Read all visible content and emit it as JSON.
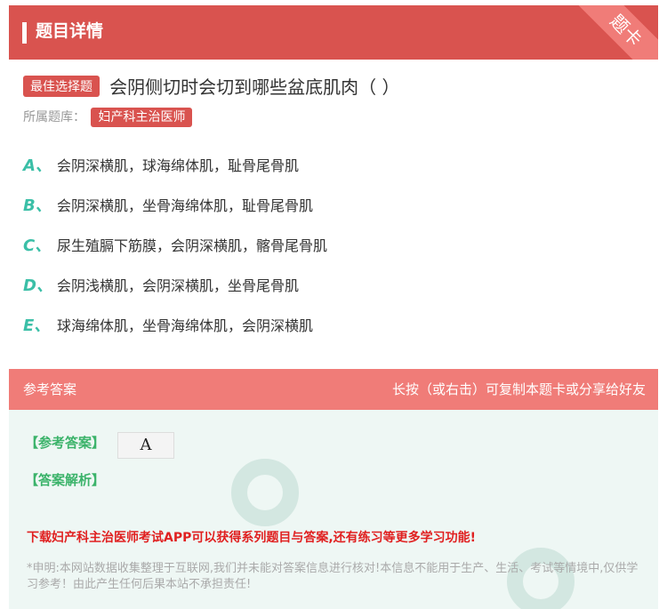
{
  "header": {
    "title": "题目详情",
    "ribbon": "题卡"
  },
  "question": {
    "type_tag": "最佳选择题",
    "text": "会阴侧切时会切到哪些盆底肌肉（ ）"
  },
  "bank": {
    "label": "所属题库：",
    "name": "妇产科主治医师"
  },
  "options": [
    {
      "letter": "A、",
      "text": "会阴深横肌，球海绵体肌，耻骨尾骨肌"
    },
    {
      "letter": "B、",
      "text": "会阴深横肌，坐骨海绵体肌，耻骨尾骨肌"
    },
    {
      "letter": "C、",
      "text": "尿生殖膈下筋膜，会阴深横肌，髂骨尾骨肌"
    },
    {
      "letter": "D、",
      "text": "会阴浅横肌，会阴深横肌，坐骨尾骨肌"
    },
    {
      "letter": "E、",
      "text": "球海绵体肌，坐骨海绵体肌，会阴深横肌"
    }
  ],
  "answer_bar": {
    "left": "参考答案",
    "right": "长按（或右击）可复制本题卡或分享给好友"
  },
  "answer": {
    "ref_label": "【参考答案】",
    "ref_value": "A",
    "analysis_label": "【答案解析】",
    "promo": "下载妇产科主治医师考试APP可以获得系列题目与答案,还有练习等更多学习功能!",
    "disclaimer": "*申明:本网站数据收集整理于互联网,我们并未能对答案信息进行核对!本信息不能用于生产、生活、考试等情境中,仅供学习参考！由此产生任何后果本站不承担责任!"
  },
  "colors": {
    "primary": "#d9534f",
    "accent": "#3bbfa7",
    "panel": "#eef7f4"
  }
}
